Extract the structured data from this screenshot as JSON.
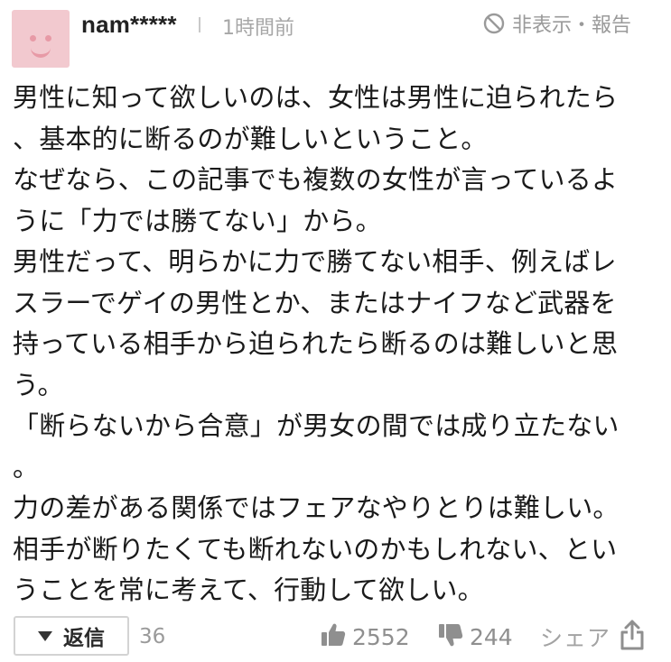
{
  "comment": {
    "username": "nam*****",
    "time": "1時間前",
    "hide_report_label": "非表示・報告",
    "body_lines": [
      "男性に知って欲しいのは、女性は男性に迫られたら",
      "、基本的に断るのが難しいということ。",
      "なぜなら、この記事でも複数の女性が言っているよ",
      "うに「力では勝てない」から。",
      "男性だって、明らかに力で勝てない相手、例えばレ",
      "スラーでゲイの男性とか、またはナイフなど武器を",
      "持っている相手から迫られたら断るのは難しいと思",
      "う。",
      "「断らないから合意」が男女の間では成り立たない",
      "。",
      "力の差がある関係ではフェアなやりとりは難しい。",
      "相手が断りたくても断れないのかもしれない、とい",
      "うことを常に考えて、行動して欲しい。"
    ],
    "reply_label": "返信",
    "reply_count": "36",
    "like_count": "2552",
    "dislike_count": "244",
    "share_label": "シェア"
  },
  "icons": {
    "avatar": "smiley-avatar",
    "hide": "prohibited-icon",
    "reply": "caret-down-icon",
    "like": "thumbs-up-icon",
    "dislike": "thumbs-down-icon",
    "share": "share-icon"
  },
  "colors": {
    "avatar_bg": "#f2c9cf",
    "avatar_face": "#e79aa6",
    "muted_text": "#9a9a9a",
    "body_text": "#1a1a1a"
  }
}
